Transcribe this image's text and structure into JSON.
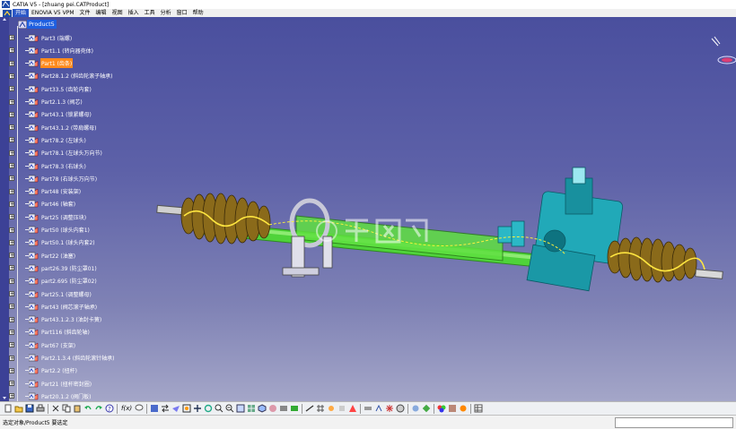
{
  "window": {
    "title": "CATIA V5 - [zhuang pei.CATProduct]"
  },
  "menubar": {
    "items": [
      "开始",
      "ENOVIA V5 VPM",
      "文件",
      "编辑",
      "视图",
      "插入",
      "工具",
      "分析",
      "窗口",
      "帮助"
    ]
  },
  "tree": {
    "root": "Product5",
    "items": [
      {
        "label": "Part3 (端螺)"
      },
      {
        "label": "Part1.1 (转向器壳体)"
      },
      {
        "label": "Part1 (齿条)",
        "selected": true
      },
      {
        "label": "Part28.1.2 (斜齿轮滚子轴承)"
      },
      {
        "label": "Part33.5 (齿轮内套)"
      },
      {
        "label": "Part2.1.3 (阀芯)"
      },
      {
        "label": "Part43.1 (锁紧螺母)"
      },
      {
        "label": "Part43.1.2 (带肩螺母)"
      },
      {
        "label": "Part78.2 (左球头)"
      },
      {
        "label": "Part78.1 (左球头万向节)"
      },
      {
        "label": "Part78.3 (右球头)"
      },
      {
        "label": "Part78 (右球头万向节)"
      },
      {
        "label": "Part48 (安装架)"
      },
      {
        "label": "Part46 (轴套)"
      },
      {
        "label": "Part25 (调整压块)"
      },
      {
        "label": "Part50 (球头内套1)"
      },
      {
        "label": "Part50.1 (球头内套2)"
      },
      {
        "label": "Part22 (油塞)"
      },
      {
        "label": "part26.39 (防尘罩01)"
      },
      {
        "label": "part2.695 (防尘罩02)"
      },
      {
        "label": "Part25.1 (调整螺母)"
      },
      {
        "label": "Part43 (阀芯滚子轴承)"
      },
      {
        "label": "Part43.1.2.3 (油封卡簧)"
      },
      {
        "label": "Part116 (斜齿轮轴)"
      },
      {
        "label": "Part67 (支架)"
      },
      {
        "label": "Part2.1.3.4 (斜齿轮滚针轴承)"
      },
      {
        "label": "Part2.2 (扭杆)"
      },
      {
        "label": "Part21 (扭杆密封圈)"
      },
      {
        "label": "Part20.1.2 (阀门板)"
      }
    ]
  },
  "toolbar": {
    "formula_label": "f(x)"
  },
  "status": {
    "text": "选定对象/Product5 要选定"
  },
  "colors": {
    "background_top": "#4a4f9e",
    "background_bottom": "#a4a6c8",
    "tree_selection": "#ff8a1c",
    "root_selection": "#1f5fe0",
    "boot": "#8a6a1a",
    "housing": "#21a9b8",
    "rack_tube": "#6ae03a"
  },
  "icons": {
    "app": "catia-logo-icon",
    "part": "part-icon",
    "compass": "compass-icon"
  }
}
